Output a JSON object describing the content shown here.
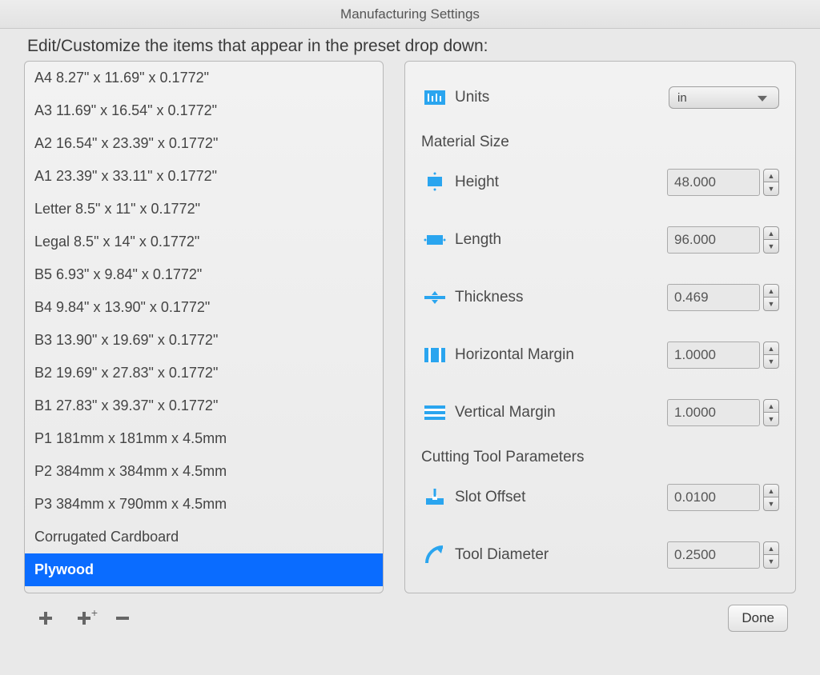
{
  "window": {
    "title": "Manufacturing Settings"
  },
  "subtitle": "Edit/Customize the items that appear in the preset drop down:",
  "presets": [
    {
      "label": "A4 8.27\" x 11.69\" x 0.1772\"",
      "selected": false
    },
    {
      "label": "A3 11.69\" x 16.54\" x 0.1772\"",
      "selected": false
    },
    {
      "label": "A2 16.54\" x 23.39\" x 0.1772\"",
      "selected": false
    },
    {
      "label": "A1 23.39\" x 33.11\" x 0.1772\"",
      "selected": false
    },
    {
      "label": "Letter 8.5\" x 11\" x 0.1772\"",
      "selected": false
    },
    {
      "label": "Legal 8.5\" x 14\" x 0.1772\"",
      "selected": false
    },
    {
      "label": "B5 6.93\" x 9.84\" x 0.1772\"",
      "selected": false
    },
    {
      "label": "B4 9.84\" x 13.90\" x 0.1772\"",
      "selected": false
    },
    {
      "label": "B3 13.90\" x 19.69\" x 0.1772\"",
      "selected": false
    },
    {
      "label": "B2 19.69\" x 27.83\" x 0.1772\"",
      "selected": false
    },
    {
      "label": "B1 27.83\" x 39.37\" x 0.1772\"",
      "selected": false
    },
    {
      "label": "P1 181mm x 181mm x 4.5mm",
      "selected": false
    },
    {
      "label": "P2 384mm x 384mm x 4.5mm",
      "selected": false
    },
    {
      "label": "P3 384mm x 790mm x 4.5mm",
      "selected": false
    },
    {
      "label": "Corrugated Cardboard",
      "selected": false
    },
    {
      "label": "Plywood",
      "selected": true
    }
  ],
  "units": {
    "label": "Units",
    "value": "in"
  },
  "sections": {
    "material_size": "Material Size",
    "cutting_tool": "Cutting Tool Parameters"
  },
  "fields": {
    "height": {
      "label": "Height",
      "value": "48.000"
    },
    "length": {
      "label": "Length",
      "value": "96.000"
    },
    "thickness": {
      "label": "Thickness",
      "value": "0.469"
    },
    "hmargin": {
      "label": "Horizontal Margin",
      "value": "1.0000"
    },
    "vmargin": {
      "label": "Vertical Margin",
      "value": "1.0000"
    },
    "slot": {
      "label": "Slot  Offset",
      "value": "0.0100"
    },
    "tooldiam": {
      "label": "Tool Diameter",
      "value": "0.2500"
    }
  },
  "buttons": {
    "done": "Done"
  }
}
